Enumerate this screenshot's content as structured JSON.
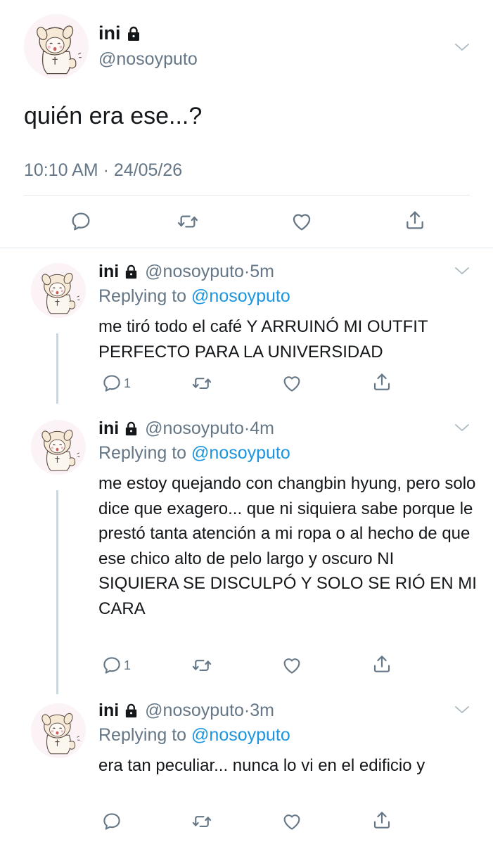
{
  "main_tweet": {
    "display_name": "ini",
    "handle": "@nosoyputo",
    "text": "quién era ese...?",
    "timestamp": "10:10 AM · 24/05/26",
    "icons": [
      "lock-icon",
      "chevron-down-icon",
      "reply-icon",
      "retweet-icon",
      "like-icon",
      "share-icon"
    ]
  },
  "replies": [
    {
      "display_name": "ini",
      "handle": "@nosoyputo",
      "time": "5m",
      "replying_prefix": "Replying to",
      "replying_handle": "@nosoyputo",
      "text": "me tiró todo el café Y ARRUINÓ MI OUTFIT PERFECTO PARA LA UNIVERSIDAD",
      "reply_count": "1"
    },
    {
      "display_name": "ini",
      "handle": "@nosoyputo",
      "time": "4m",
      "replying_prefix": "Replying to",
      "replying_handle": "@nosoyputo",
      "text": "me estoy quejando con changbin hyung, pero solo dice que exagero... que ni siquiera sabe porque le prestó tanta atención a mi ropa o al hecho de que ese chico alto de pelo largo y oscuro NI SIQUIERA SE DISCULPÓ Y SOLO SE RIÓ EN MI CARA",
      "reply_count": "1"
    },
    {
      "display_name": "ini",
      "handle": "@nosoyputo",
      "time": "3m",
      "replying_prefix": "Replying to",
      "replying_handle": "@nosoyputo",
      "text": "era tan peculiar... nunca lo vi en el edificio y",
      "reply_count": ""
    }
  ],
  "separator": " · ",
  "colors": {
    "text": "#14171a",
    "muted": "#657786",
    "link": "#1b95e0",
    "divider": "#e1e8ed",
    "thread_line": "#ccd6dd"
  }
}
